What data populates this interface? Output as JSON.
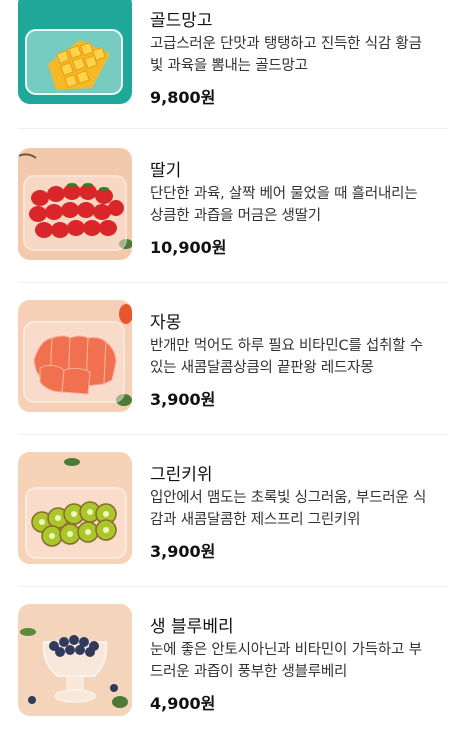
{
  "products": [
    {
      "name": "골드망고",
      "desc_lines": [
        "고급스러운 단맛과 탱탱하고 진득한 식감 황금",
        "빛 과육을 뽐내는 골드망고"
      ],
      "price": "9,800원",
      "image": "mango-in-container"
    },
    {
      "name": "딸기",
      "desc_lines": [
        "단단한 과육, 살짝 베어 물었을 때 흘러내리는",
        "상큼한 과즙을 머금은 생딸기"
      ],
      "price": "10,900원",
      "image": "strawberries-in-container"
    },
    {
      "name": "자몽",
      "desc_lines": [
        "반개만 먹어도 하루 필요 비타민C를 섭취할 수",
        "있는 새콤달콤상큼의 끝판왕 레드자몽"
      ],
      "price": "3,900원",
      "image": "grapefruit-in-container"
    },
    {
      "name": "그린키위",
      "desc_lines": [
        "입안에서 맴도는 초록빛 싱그러움, 부드러운 식",
        "감과 새콤달콤한 제스프리 그린키위"
      ],
      "price": "3,900원",
      "image": "kiwi-in-container"
    },
    {
      "name": "생 블루베리",
      "desc_lines": [
        "눈에 좋은 안토시아닌과 비타민이 가득하고 부",
        "드러운 과즙이 풍부한 생블루베리"
      ],
      "price": "4,900원",
      "image": "blueberries-in-glass"
    }
  ]
}
